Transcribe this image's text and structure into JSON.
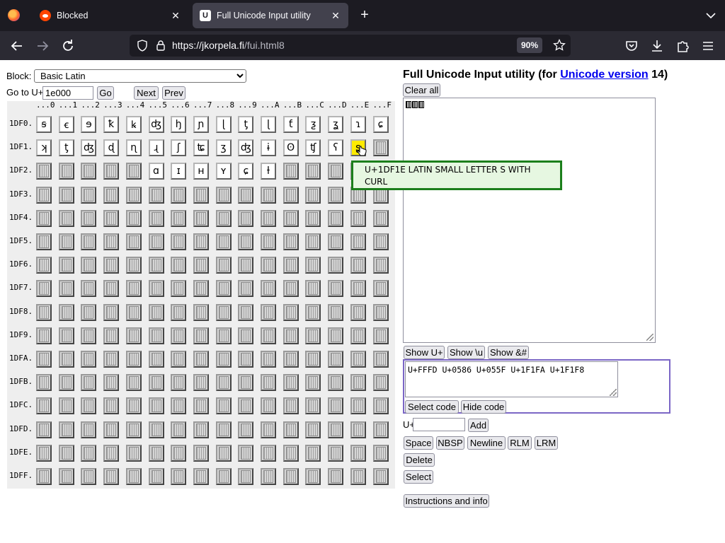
{
  "browser": {
    "tabs": [
      {
        "title": "Blocked",
        "close": "✕"
      },
      {
        "title": "Full Unicode Input utility",
        "close": "✕"
      }
    ],
    "new_tab": "+",
    "url_host": "https://jkorpela.fi",
    "url_path": "/fui.html8",
    "zoom": "90%"
  },
  "page": {
    "block_label": "Block:",
    "block_selected": "Basic Latin",
    "goto_label": "Go to U+",
    "goto_value": "1e000",
    "go_button": "Go",
    "next_button": "Next",
    "prev_button": "Prev",
    "title_prefix": "Full Unicode Input utility (for ",
    "title_link": "Unicode version",
    "title_suffix": " 14)",
    "clear_all": "Clear all",
    "show_u": "Show U+",
    "show_backslash_u": "Show \\u",
    "show_amp": "Show &#",
    "code_text": "U+FFFD U+0586 U+055F U+1F1FA U+1F1F8",
    "select_code": "Select code",
    "hide_code": "Hide code",
    "u_plus_label": "U+",
    "add_button": "Add",
    "space": "Space",
    "nbsp": "NBSP",
    "newline": "Newline",
    "rlm": "RLM",
    "lrm": "LRM",
    "delete": "Delete",
    "select": "Select",
    "instructions": "Instructions and info",
    "tooltip": "U+1DF1E LATIN SMALL LETTER S WITH CURL"
  },
  "grid": {
    "col_headers": [
      "...0",
      "...1",
      "...2",
      "...3",
      "...4",
      "...5",
      "...6",
      "...7",
      "...8",
      "...9",
      "...A",
      "...B",
      "...C",
      "...D",
      "...E",
      "...F"
    ],
    "row_headers": [
      "1DF0.",
      "1DF1.",
      "1DF2.",
      "1DF3.",
      "1DF4.",
      "1DF5.",
      "1DF6.",
      "1DF7.",
      "1DF8.",
      "1DF9.",
      "1DFA.",
      "1DFB.",
      "1DFC.",
      "1DFD.",
      "1DFE.",
      "1DFF."
    ],
    "row0": [
      "ꞩ",
      "ꞓ",
      "ɘ",
      "ꝁ",
      "ꝃ",
      "ʤ",
      "ꜧ",
      "ɲ",
      "ɭ",
      "ƫ",
      "ɭ",
      "ƭ",
      "ƺ",
      "ʓ",
      "ɿ",
      "ɕ"
    ],
    "row1": [
      "ʞ",
      "ƫ",
      "ʤ",
      "ɖ",
      "ɳ",
      "ɻ",
      "ʃ",
      "ʨ",
      "ʒ",
      "ʤ",
      "ɨ",
      "ʘ",
      "ʧ",
      "ʕ",
      "ʂ",
      ""
    ],
    "row2": [
      "",
      "",
      "",
      "",
      "",
      "ɑ",
      "ɪ",
      "ʜ",
      "ʏ",
      "ɕ",
      "ƚ",
      "",
      "",
      "",
      "",
      ""
    ],
    "hover_cell": "1DF1E"
  }
}
